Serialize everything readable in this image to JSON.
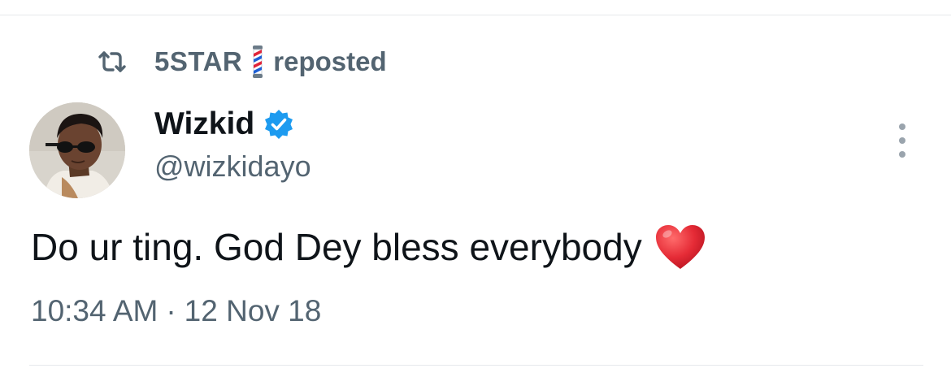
{
  "repost": {
    "reposter_name": "5STAR",
    "reposter_emoji": "barber-pole-emoji",
    "label": "reposted",
    "icon": "repost-icon"
  },
  "author": {
    "display_name": "Wizkid",
    "verified": true,
    "verified_icon": "verified-badge-icon",
    "handle": "@wizkidayo",
    "avatar": "avatar-photo"
  },
  "tweet": {
    "text": "Do ur ting. God Dey bless everybody",
    "trailing_emoji": "red-heart-emoji"
  },
  "meta": {
    "time": "10:34 AM",
    "separator": "·",
    "date": "12 Nov 18"
  },
  "menu": {
    "icon": "more-options-icon"
  },
  "colors": {
    "text_primary": "#0f1419",
    "text_secondary": "#536471",
    "verified_blue": "#1d9bf0",
    "heart_red": "#e0243a",
    "divider": "#e6e9ec"
  }
}
